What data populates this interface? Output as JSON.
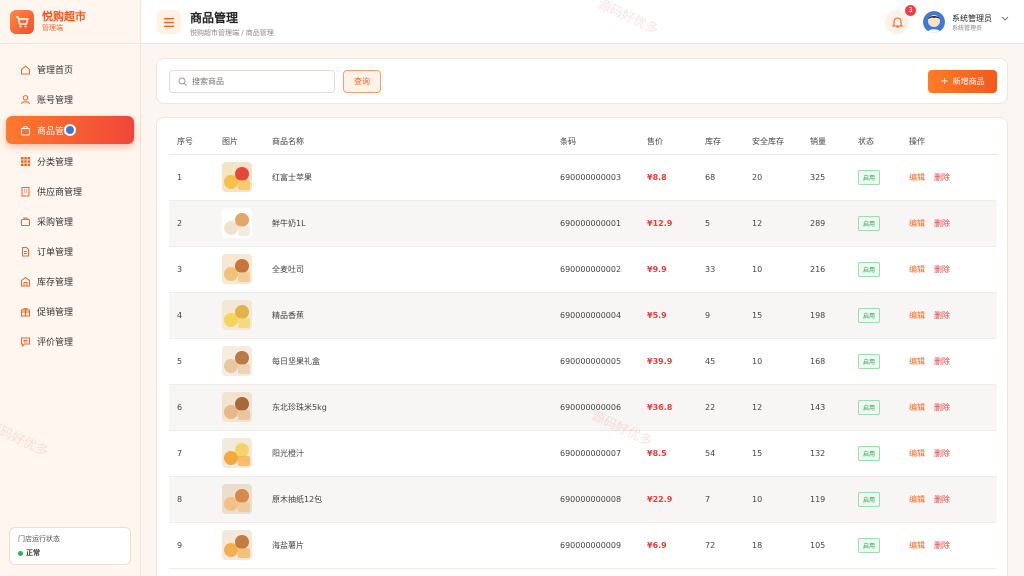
{
  "brand": {
    "name": "悦购超市",
    "sub": "管理端"
  },
  "sidebar": {
    "items": [
      {
        "label": "管理首页",
        "icon": "home-icon",
        "name": "sidebar-item-home"
      },
      {
        "label": "账号管理",
        "icon": "user-icon",
        "name": "sidebar-item-accounts"
      },
      {
        "label": "商品管理",
        "icon": "bag-icon",
        "name": "sidebar-item-products",
        "active": true
      },
      {
        "label": "分类管理",
        "icon": "grid-icon",
        "name": "sidebar-item-categories"
      },
      {
        "label": "供应商管理",
        "icon": "building-icon",
        "name": "sidebar-item-suppliers"
      },
      {
        "label": "采购管理",
        "icon": "briefcase-icon",
        "name": "sidebar-item-purchase"
      },
      {
        "label": "订单管理",
        "icon": "document-icon",
        "name": "sidebar-item-orders"
      },
      {
        "label": "库存管理",
        "icon": "warehouse-icon",
        "name": "sidebar-item-inventory"
      },
      {
        "label": "促销管理",
        "icon": "gift-icon",
        "name": "sidebar-item-promotions"
      },
      {
        "label": "评价管理",
        "icon": "chat-icon",
        "name": "sidebar-item-reviews"
      }
    ],
    "status": {
      "label": "门店运行状态",
      "value": "正常"
    }
  },
  "header": {
    "title": "商品管理",
    "breadcrumb": "悦购超市管理端 / 商品管理",
    "notifications": "3",
    "user_name": "系统管理员",
    "user_role": "系统管理员"
  },
  "filter": {
    "search_placeholder": "搜索商品",
    "query_label": "查询",
    "add_label": "新增商品"
  },
  "table": {
    "columns": [
      "序号",
      "图片",
      "商品名称",
      "条码",
      "售价",
      "库存",
      "安全库存",
      "销量",
      "状态",
      "操作"
    ],
    "edit_label": "编辑",
    "delete_label": "删除",
    "rows": [
      {
        "no": "1",
        "name": "红富士苹果",
        "barcode": "690000000003",
        "price": "¥8.8",
        "stock": "68",
        "safe": "20",
        "sales": "325",
        "status": "启用"
      },
      {
        "no": "2",
        "name": "鲜牛奶1L",
        "barcode": "690000000001",
        "price": "¥12.9",
        "stock": "5",
        "safe": "12",
        "sales": "289",
        "status": "启用"
      },
      {
        "no": "3",
        "name": "全麦吐司",
        "barcode": "690000000002",
        "price": "¥9.9",
        "stock": "33",
        "safe": "10",
        "sales": "216",
        "status": "启用"
      },
      {
        "no": "4",
        "name": "精品香蕉",
        "barcode": "690000000004",
        "price": "¥5.9",
        "stock": "9",
        "safe": "15",
        "sales": "198",
        "status": "启用"
      },
      {
        "no": "5",
        "name": "每日坚果礼盒",
        "barcode": "690000000005",
        "price": "¥39.9",
        "stock": "45",
        "safe": "10",
        "sales": "168",
        "status": "启用"
      },
      {
        "no": "6",
        "name": "东北珍珠米5kg",
        "barcode": "690000000006",
        "price": "¥36.8",
        "stock": "22",
        "safe": "12",
        "sales": "143",
        "status": "启用"
      },
      {
        "no": "7",
        "name": "阳光橙汁",
        "barcode": "690000000007",
        "price": "¥8.5",
        "stock": "54",
        "safe": "15",
        "sales": "132",
        "status": "启用"
      },
      {
        "no": "8",
        "name": "原木抽纸12包",
        "barcode": "690000000008",
        "price": "¥22.9",
        "stock": "7",
        "safe": "10",
        "sales": "119",
        "status": "启用"
      },
      {
        "no": "9",
        "name": "海盐薯片",
        "barcode": "690000000009",
        "price": "¥6.9",
        "stock": "72",
        "safe": "18",
        "sales": "105",
        "status": "启用"
      }
    ]
  },
  "watermark": "源码好优多",
  "colors": {
    "accent": "#f2551f",
    "price": "#e63d3d",
    "ok": "#27b35a"
  }
}
